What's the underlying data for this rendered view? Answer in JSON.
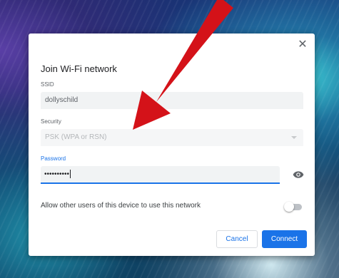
{
  "dialog": {
    "title": "Join Wi-Fi network",
    "close_icon": "close-icon",
    "ssid": {
      "label": "SSID",
      "value": "dollyschild"
    },
    "security": {
      "label": "Security",
      "value": "PSK (WPA or RSN)"
    },
    "password": {
      "label": "Password",
      "value": "••••••••••",
      "show_icon": "eye-icon"
    },
    "allow_other_users": {
      "label": "Allow other users of this device to use this network",
      "enabled": false
    },
    "buttons": {
      "cancel": "Cancel",
      "connect": "Connect"
    }
  },
  "overlay": {
    "annotation_icon": "red-arrow-icon"
  },
  "colors": {
    "accent": "#1a73e8",
    "arrow": "#d41219",
    "field_bg": "#f1f3f4",
    "text_primary": "#202124",
    "text_secondary": "#5f6368"
  }
}
